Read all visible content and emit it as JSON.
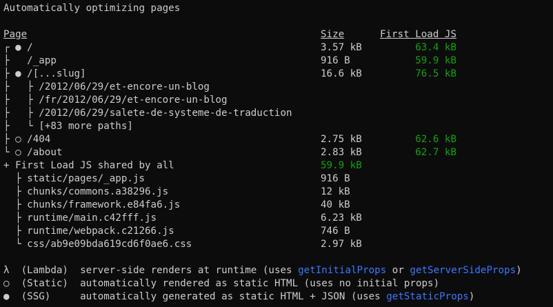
{
  "header": {
    "title": "Automatically optimizing pages"
  },
  "columns": {
    "page": "Page",
    "size": "Size",
    "first_load": "First Load JS"
  },
  "rows": [
    {
      "tree": "┌ ● ",
      "path": "/",
      "size": "3.57 kB",
      "first_load": "63.4 kB"
    },
    {
      "tree": "├   ",
      "path": "/_app",
      "size": "916 B",
      "first_load": "59.9 kB"
    },
    {
      "tree": "├ ● ",
      "path": "/[...slug]",
      "size": "16.6 kB",
      "first_load": "76.5 kB"
    },
    {
      "tree": "├   ├ ",
      "path": "/2012/06/29/et-encore-un-blog",
      "size": "",
      "first_load": ""
    },
    {
      "tree": "├   ├ ",
      "path": "/fr/2012/06/29/et-encore-un-blog",
      "size": "",
      "first_load": ""
    },
    {
      "tree": "├   ├ ",
      "path": "/2012/06/29/salete-de-systeme-de-traduction",
      "size": "",
      "first_load": ""
    },
    {
      "tree": "├   └ ",
      "path": "[+83 more paths]",
      "size": "",
      "first_load": ""
    },
    {
      "tree": "├ ○ ",
      "path": "/404",
      "size": "2.75 kB",
      "first_load": "62.6 kB"
    },
    {
      "tree": "└ ○ ",
      "path": "/about",
      "size": "2.83 kB",
      "first_load": "62.7 kB"
    }
  ],
  "shared": {
    "label": "+ First Load JS shared by all",
    "size": "59.9 kB",
    "files": [
      {
        "tree": "  ├ ",
        "name": "static/pages/_app.js",
        "size": "916 B"
      },
      {
        "tree": "  ├ ",
        "name": "chunks/commons.a38296.js",
        "size": "12 kB"
      },
      {
        "tree": "  ├ ",
        "name": "chunks/framework.e84fa6.js",
        "size": "40 kB"
      },
      {
        "tree": "  ├ ",
        "name": "runtime/main.c42fff.js",
        "size": "6.23 kB"
      },
      {
        "tree": "  ├ ",
        "name": "runtime/webpack.c21266.js",
        "size": "746 B"
      },
      {
        "tree": "  └ ",
        "name": "css/ab9e09bda619cd6f0ae6.css",
        "size": "2.97 kB"
      }
    ]
  },
  "legend": [
    {
      "symbol": "λ",
      "type": "(Lambda)",
      "desc_before": "server-side renders at runtime (uses ",
      "fn1": "getInitialProps",
      "mid": " or ",
      "fn2": "getServerSideProps",
      "after": ")"
    },
    {
      "symbol": "○",
      "type": "(Static)",
      "desc_before": "automatically rendered as static HTML (uses no initial props)",
      "fn1": "",
      "mid": "",
      "fn2": "",
      "after": ""
    },
    {
      "symbol": "●",
      "type": "(SSG)",
      "desc_before": "automatically generated as static HTML + JSON (uses ",
      "fn1": "getStaticProps",
      "mid": "",
      "fn2": "",
      "after": ")"
    }
  ],
  "colors": {
    "background": "#0c0c0c",
    "text": "#cccccc",
    "green": "#13a10e",
    "blue": "#3b78ff"
  }
}
